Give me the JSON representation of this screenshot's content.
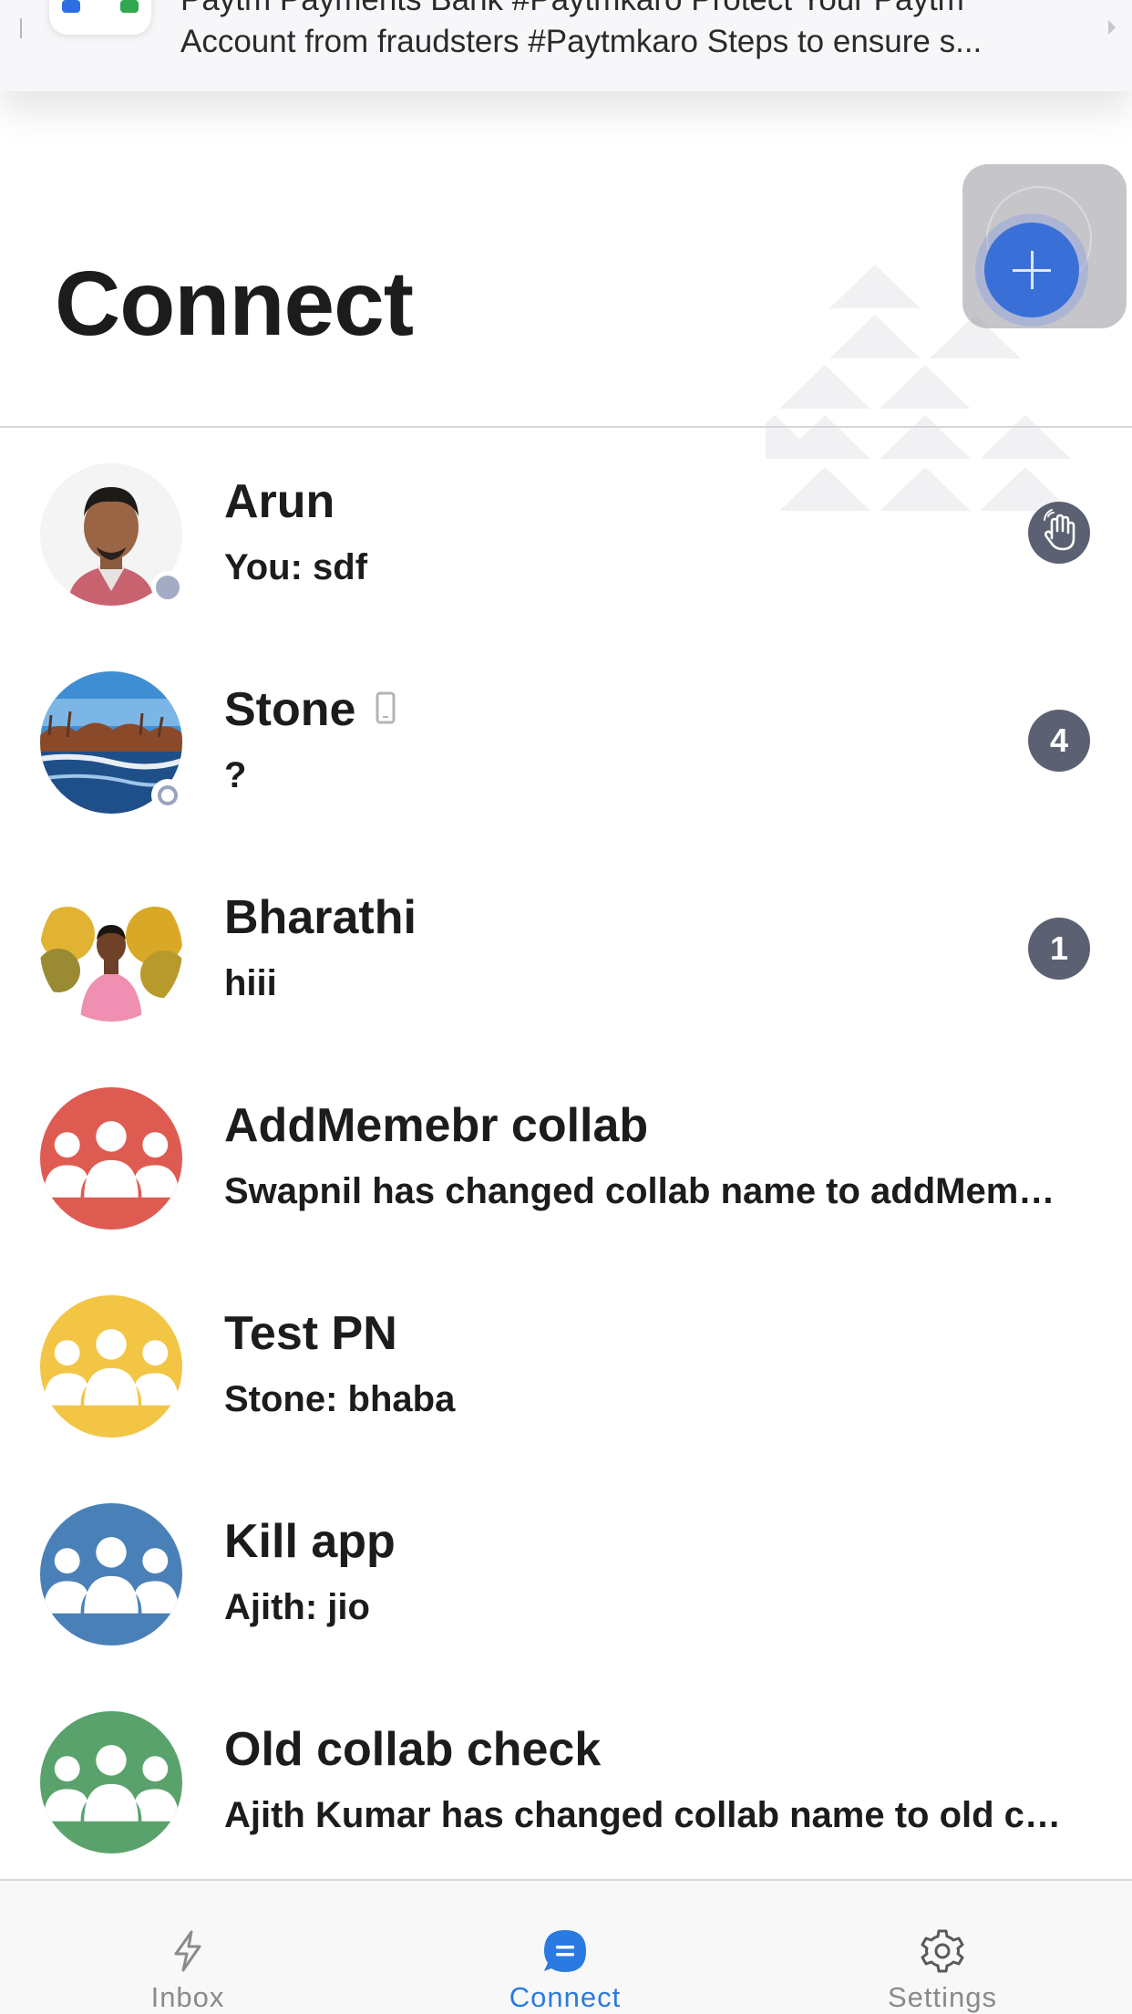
{
  "notification": {
    "line1": "Paytm Payments Bank #Paytmkaro Protect Your Paytm",
    "line2": "Account from fraudsters #Paytmkaro Steps to ensure s..."
  },
  "header": {
    "title": "Connect",
    "fab_icon": "plus-icon"
  },
  "conversations": [
    {
      "name": "Arun",
      "preview": "You: sdf",
      "avatar": "photo",
      "presence": "away",
      "trailing": "wave-icon"
    },
    {
      "name": "Stone",
      "preview": "?",
      "avatar": "photo",
      "presence": "offline",
      "device": "mobile-device-icon",
      "badge": "4"
    },
    {
      "name": "Bharathi",
      "preview": "hiii",
      "avatar": "photo",
      "badge": "1"
    },
    {
      "name": "AddMemebr collab",
      "preview": "Swapnil has changed collab name to addMemebr collab",
      "avatar": "group-icon",
      "color": "#de5b52"
    },
    {
      "name": "Test PN",
      "preview": "Stone: bhaba",
      "avatar": "group-icon",
      "color": "#f3c545"
    },
    {
      "name": "Kill app",
      "preview": "Ajith: jio",
      "avatar": "group-icon",
      "color": "#4a80b8"
    },
    {
      "name": "Old collab check",
      "preview": "Ajith Kumar has changed collab name to old collab check",
      "avatar": "group-icon",
      "color": "#5aa26b"
    }
  ],
  "tabs": [
    {
      "label": "Inbox",
      "icon": "lightning-icon",
      "active": false
    },
    {
      "label": "Connect",
      "icon": "chat-bubble-icon",
      "active": true
    },
    {
      "label": "Settings",
      "icon": "gear-icon",
      "active": false
    }
  ],
  "colors": {
    "accent": "#2a7ae2",
    "badge": "#5b6072",
    "group_red": "#de5b52",
    "group_yellow": "#f3c545",
    "group_blue": "#4a80b8",
    "group_green": "#5aa26b"
  }
}
